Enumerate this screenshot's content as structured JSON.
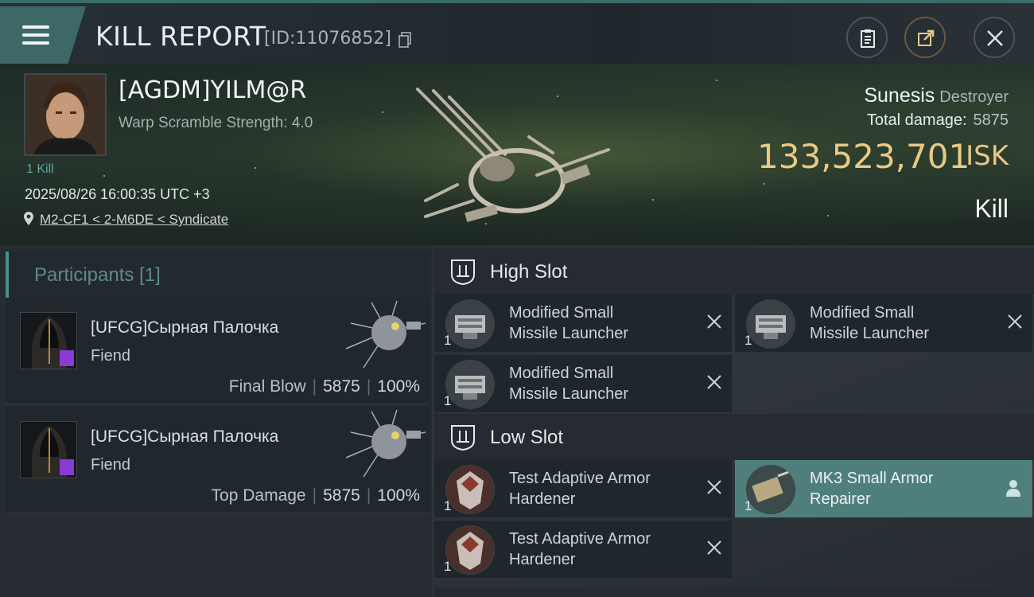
{
  "header": {
    "title": "KILL REPORT",
    "kill_id": "[ID:11076852]"
  },
  "icons": {
    "menu": "menu-icon",
    "copy": "copy-icon",
    "clipboard": "clipboard-icon",
    "share": "share-icon",
    "close": "close-icon",
    "location": "map-pin-icon",
    "remove": "remove-x-icon",
    "pilot": "person-icon"
  },
  "victim": {
    "name": "[AGDM]YILM@R",
    "warp_scramble": "Warp Scramble Strength: 4.0",
    "kill_count": "1 Kill",
    "timestamp": "2025/08/26 16:00:35 UTC +3",
    "location": "M2-CF1 < 2-M6DE < Syndicate"
  },
  "ship": {
    "name": "Sunesis",
    "class": "Destroyer",
    "total_damage_label": "Total damage:",
    "total_damage_value": "5875",
    "isk_value": "133,523,701",
    "isk_unit": "ISK",
    "result": "Kill"
  },
  "participants": {
    "title": "Participants [1]",
    "rows": [
      {
        "name": "[UFCG]Сырная Палочка",
        "ship": "Fiend",
        "role": "Final Blow",
        "damage": "5875",
        "percent": "100%"
      },
      {
        "name": "[UFCG]Сырная Палочка",
        "ship": "Fiend",
        "role": "Top Damage",
        "damage": "5875",
        "percent": "100%"
      }
    ]
  },
  "slots": {
    "high": {
      "label": "High Slot",
      "modules": [
        {
          "qty": "1",
          "line1": "Modified Small",
          "line2": "Missile Launcher"
        },
        {
          "qty": "1",
          "line1": "Modified Small",
          "line2": "Missile Launcher"
        },
        {
          "qty": "1",
          "line1": "Modified Small",
          "line2": "Missile Launcher"
        }
      ]
    },
    "low": {
      "label": "Low Slot",
      "modules": [
        {
          "qty": "1",
          "line1": "Test Adaptive Armor",
          "line2": "Hardener"
        },
        {
          "qty": "1",
          "line1": "MK3 Small Armor",
          "line2": "Repairer"
        },
        {
          "qty": "1",
          "line1": "Test Adaptive Armor",
          "line2": "Hardener"
        }
      ]
    }
  },
  "colors": {
    "accent": "#4a8f8c",
    "isk_gold": "#e8c987",
    "badge_purple": "#8c3ad6",
    "active_module": "#4f7f7d"
  }
}
